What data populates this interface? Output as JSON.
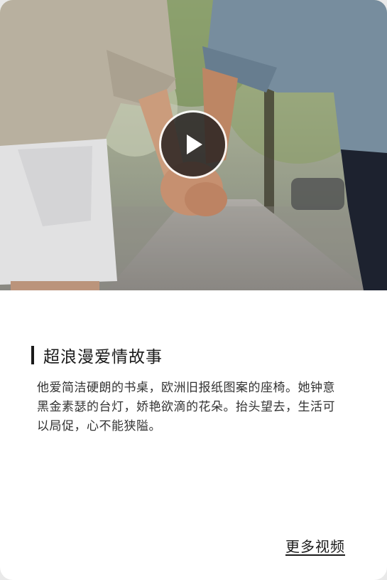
{
  "video": {
    "thumbnail_alt": "holding-hands-scene",
    "play_icon": "play-icon"
  },
  "article": {
    "title": "超浪漫爱情故事",
    "description": "他爱简洁硬朗的书桌，欧洲旧报纸图案的座椅。她钟意黑金素瑟的台灯，娇艳欲滴的花朵。抬头望去，生活可以局促，心不能狭隘。"
  },
  "footer": {
    "more_label": "更多视频"
  }
}
